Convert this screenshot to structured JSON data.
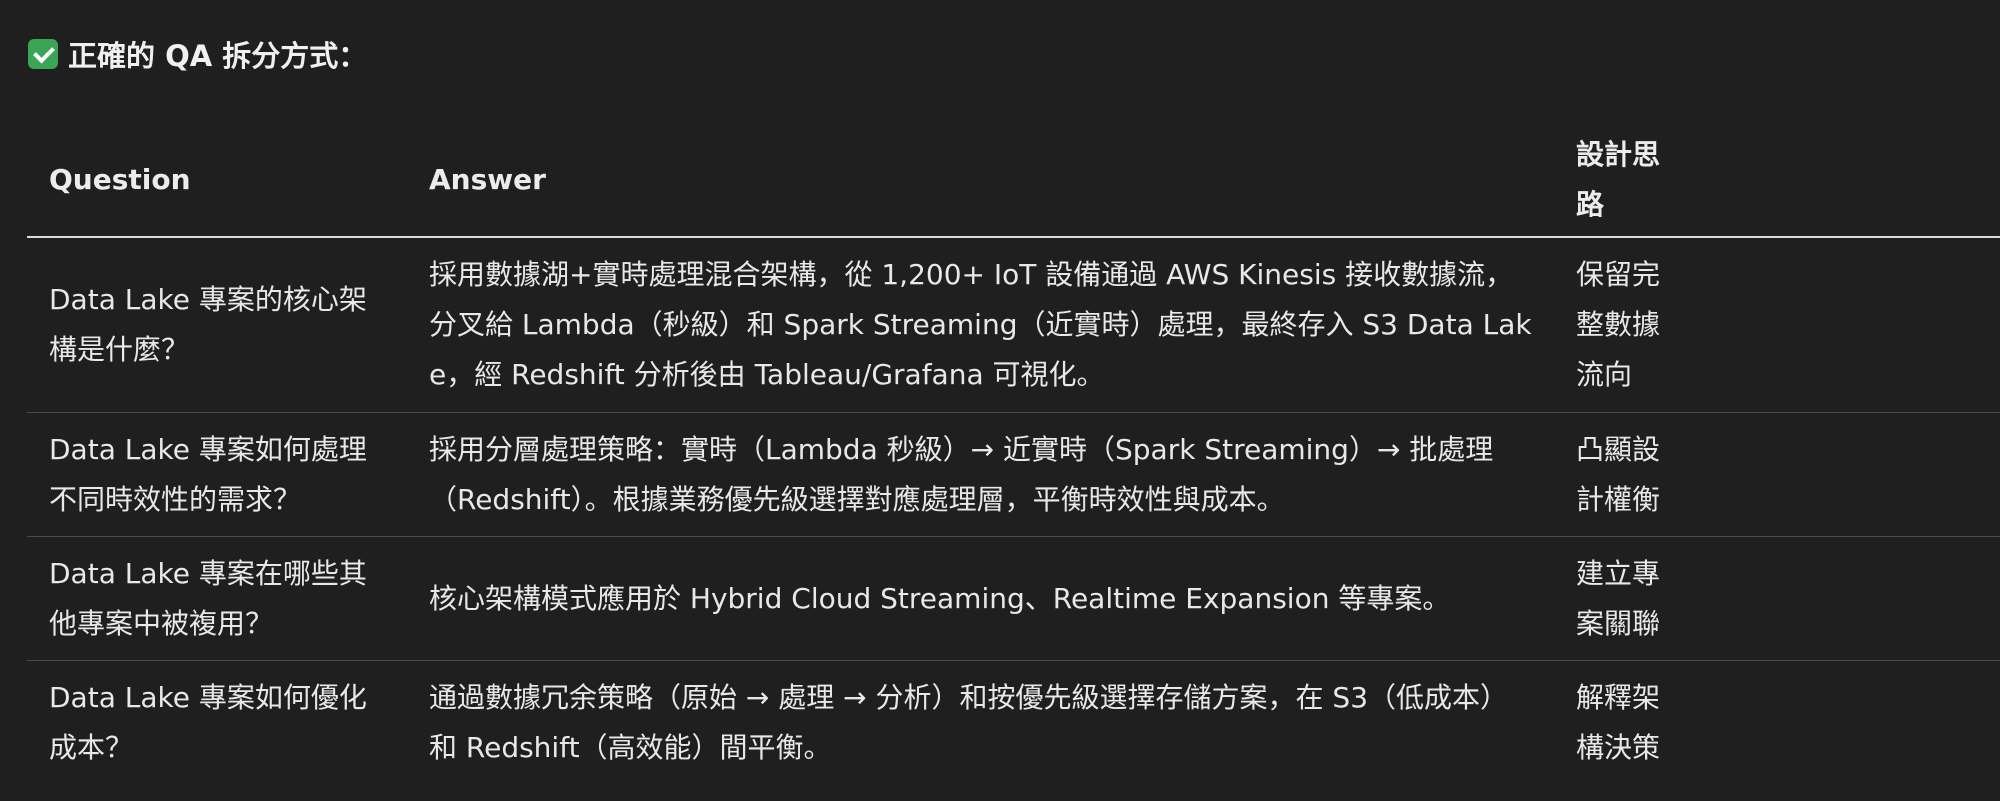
{
  "heading": {
    "icon": "check-mark-icon",
    "icon_color": "#3aa655",
    "text": "正確的 QA 拆分方式："
  },
  "table": {
    "headers": {
      "question": "Question",
      "answer": "Answer",
      "design": "設計思路"
    },
    "rows": [
      {
        "question": "Data Lake 專案的核心架構是什麼？",
        "answer": "採用數據湖+實時處理混合架構，從 1,200+ IoT 設備通過 AWS Kinesis 接收數據流，分叉給 Lambda（秒級）和 Spark Streaming（近實時）處理，最終存入 S3 Data Lake，經 Redshift 分析後由 Tableau/Grafana 可視化。",
        "design": "保留完整數據流向"
      },
      {
        "question": "Data Lake 專案如何處理不同時效性的需求？",
        "answer": "採用分層處理策略：實時（Lambda 秒級）→ 近實時（Spark Streaming）→ 批處理（Redshift）。根據業務優先級選擇對應處理層，平衡時效性與成本。",
        "design": "凸顯設計權衡"
      },
      {
        "question": "Data Lake 專案在哪些其他專案中被複用？",
        "answer": "核心架構模式應用於 Hybrid Cloud Streaming、Realtime Expansion 等專案。",
        "design": "建立專案關聯"
      },
      {
        "question": "Data Lake 專案如何優化成本？",
        "answer": "通過數據冗余策略（原始 → 處理 → 分析）和按優先級選擇存儲方案，在 S3（低成本）和 Redshift（高效能）間平衡。",
        "design": "解釋架構決策"
      }
    ]
  }
}
